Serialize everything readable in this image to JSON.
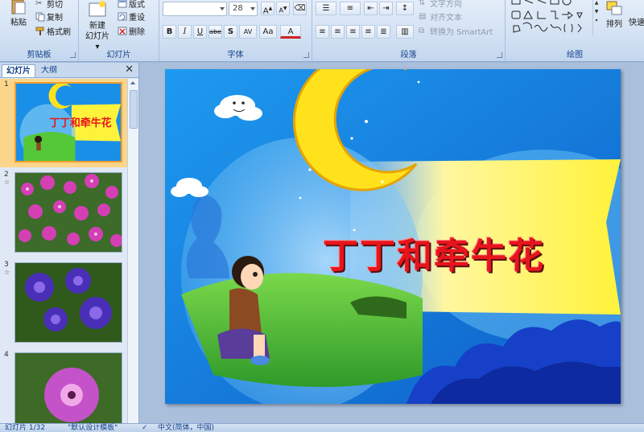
{
  "ribbon": {
    "clipboard": {
      "paste": "粘贴",
      "cut": "剪切",
      "copy": "复制",
      "format_painter": "格式刷",
      "label": "剪贴板"
    },
    "slides": {
      "new_slide": "新建",
      "new_slide_line2": "幻灯片",
      "layout": "版式",
      "reset": "重设",
      "delete": "删除",
      "label": "幻灯片"
    },
    "font": {
      "font_name": "",
      "font_size": "28",
      "bold": "B",
      "italic": "I",
      "underline": "U",
      "strike": "abe",
      "shadow": "S",
      "spacing": "AV",
      "case": "Aa",
      "color": "A",
      "grow": "A",
      "shrink": "A",
      "label": "字体"
    },
    "paragraph": {
      "text_direction": "文字方向",
      "align_text": "对齐文本",
      "smartart": "转换为 SmartArt",
      "label": "段落"
    },
    "drawing": {
      "arrange": "排列",
      "quick_styles": "快速",
      "label": "绘图"
    }
  },
  "pane": {
    "tab_slides": "幻灯片",
    "tab_outline": "大纲",
    "slides": [
      {
        "number": "1",
        "star": ""
      },
      {
        "number": "2",
        "star": "☆"
      },
      {
        "number": "3",
        "star": "☆"
      },
      {
        "number": "4",
        "star": ""
      }
    ]
  },
  "slide": {
    "title": "丁丁和牵牛花"
  },
  "status": {
    "slide_count": "幻灯片 1/32",
    "theme": "\"默认设计模板\"",
    "language": "中文(简体，中国)"
  },
  "colors": {
    "sky": "#1a8fe8",
    "moon": "#ffe21c",
    "banner": "#fff23a",
    "grass": "#55c83a",
    "title": "#e8141c"
  }
}
